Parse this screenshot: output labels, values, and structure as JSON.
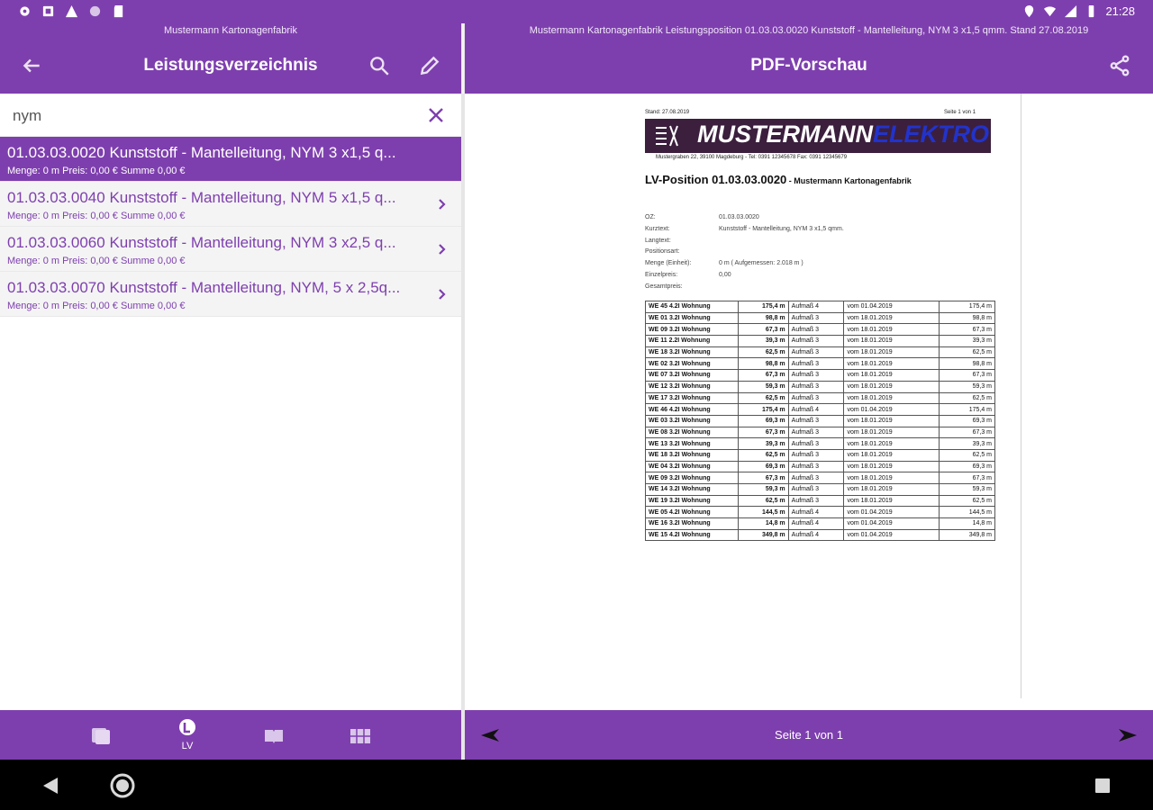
{
  "status_bar": {
    "time": "21:28",
    "left_icons": [
      "gear-icon",
      "image-icon",
      "warning-icon",
      "circle-icon",
      "sd-card-icon"
    ],
    "right_icons": [
      "location-icon",
      "wifi-icon",
      "signal-icon",
      "battery-icon"
    ]
  },
  "left_pane": {
    "subtitle": "Mustermann Kartonagenfabrik",
    "title": "Leistungsverzeichnis",
    "search": {
      "value": "nym",
      "placeholder": ""
    },
    "items": [
      {
        "title": "01.03.03.0020 Kunststoff - Mantelleitung, NYM 3 x1,5 q...",
        "meta": "Menge: 0 m Preis: 0,00 € Summe 0,00 €",
        "selected": true
      },
      {
        "title": "01.03.03.0040 Kunststoff - Mantelleitung, NYM 5 x1,5 q...",
        "meta": "Menge: 0 m Preis: 0,00 € Summe 0,00 €",
        "selected": false
      },
      {
        "title": "01.03.03.0060 Kunststoff - Mantelleitung, NYM 3 x2,5 q...",
        "meta": "Menge: 0 m Preis: 0,00 € Summe 0,00 €",
        "selected": false
      },
      {
        "title": "01.03.03.0070 Kunststoff - Mantelleitung, NYM, 5 x 2,5q...",
        "meta": "Menge: 0 m Preis: 0,00 € Summe 0,00 €",
        "selected": false
      }
    ],
    "bottom_tabs": [
      {
        "icon": "documents-icon",
        "label": ""
      },
      {
        "icon": "lv-icon",
        "label": "LV"
      },
      {
        "icon": "book-icon",
        "label": ""
      },
      {
        "icon": "grid-icon",
        "label": ""
      }
    ]
  },
  "right_pane": {
    "subtitle": "Mustermann Kartonagenfabrik Leistungsposition 01.03.03.0020 Kunststoff - Mantelleitung, NYM 3 x1,5 qmm. Stand 27.08.2019",
    "title": "PDF-Vorschau",
    "pager": "Seite 1 von 1"
  },
  "pdf": {
    "stand": "Stand: 27.08.2019",
    "page": "Seite 1 von 1",
    "logo_text_a": "MUSTERMANN",
    "logo_text_b": "ELEKTRO",
    "address": "Mustergraben 22, 39100 Magdeburg  -  Tel: 0391 12345678  Fax: 0391 12345679",
    "heading": "LV-Position 01.03.03.0020",
    "heading_small": " - Mustermann Kartonagenfabrik",
    "info": [
      {
        "label": "OZ:",
        "value": "01.03.03.0020"
      },
      {
        "label": "Kurztext:",
        "value": "Kunststoff - Mantelleitung, NYM 3 x1,5 qmm."
      },
      {
        "label": "Langtext:",
        "value": ""
      },
      {
        "label": "Positionsart:",
        "value": ""
      },
      {
        "label": "Menge (Einheit):",
        "value": "0 m ( Aufgemessen: 2.018 m )"
      },
      {
        "label": "Einzelpreis:",
        "value": "0,00"
      },
      {
        "label": "Gesamtpreis:",
        "value": ""
      }
    ],
    "rows": [
      [
        "WE 45 4.2I Wohnung",
        "175,4 m",
        "Aufmaß 4",
        "vom 01.04.2019",
        "175,4 m"
      ],
      [
        "WE 01 3.2I Wohnung",
        "98,8 m",
        "Aufmaß 3",
        "vom 18.01.2019",
        "98,8 m"
      ],
      [
        "WE 09 3.2I Wohnung",
        "67,3 m",
        "Aufmaß 3",
        "vom 18.01.2019",
        "67,3 m"
      ],
      [
        "WE 11 2.2I Wohnung",
        "39,3 m",
        "Aufmaß 3",
        "vom 18.01.2019",
        "39,3 m"
      ],
      [
        "WE 18 3.2I Wohnung",
        "62,5 m",
        "Aufmaß 3",
        "vom 18.01.2019",
        "62,5 m"
      ],
      [
        "WE 02 3.2I Wohnung",
        "98,8 m",
        "Aufmaß 3",
        "vom 18.01.2019",
        "98,8 m"
      ],
      [
        "WE 07 3.2I Wohnung",
        "67,3 m",
        "Aufmaß 3",
        "vom 18.01.2019",
        "67,3 m"
      ],
      [
        "WE 12 3.2I Wohnung",
        "59,3 m",
        "Aufmaß 3",
        "vom 18.01.2019",
        "59,3 m"
      ],
      [
        "WE 17 3.2I Wohnung",
        "62,5 m",
        "Aufmaß 3",
        "vom 18.01.2019",
        "62,5 m"
      ],
      [
        "WE 46 4.2I Wohnung",
        "175,4 m",
        "Aufmaß 4",
        "vom 01.04.2019",
        "175,4 m"
      ],
      [
        "WE 03 3.2I Wohnung",
        "69,3 m",
        "Aufmaß 3",
        "vom 18.01.2019",
        "69,3 m"
      ],
      [
        "WE 08 3.2I Wohnung",
        "67,3 m",
        "Aufmaß 3",
        "vom 18.01.2019",
        "67,3 m"
      ],
      [
        "WE 13 3.2I Wohnung",
        "39,3 m",
        "Aufmaß 3",
        "vom 18.01.2019",
        "39,3 m"
      ],
      [
        "WE 18 3.2I Wohnung",
        "62,5 m",
        "Aufmaß 3",
        "vom 18.01.2019",
        "62,5 m"
      ],
      [
        "WE 04 3.2I Wohnung",
        "69,3 m",
        "Aufmaß 3",
        "vom 18.01.2019",
        "69,3 m"
      ],
      [
        "WE 09 3.2I Wohnung",
        "67,3 m",
        "Aufmaß 3",
        "vom 18.01.2019",
        "67,3 m"
      ],
      [
        "WE 14 3.2I Wohnung",
        "59,3 m",
        "Aufmaß 3",
        "vom 18.01.2019",
        "59,3 m"
      ],
      [
        "WE 19 3.2I Wohnung",
        "62,5 m",
        "Aufmaß 3",
        "vom 18.01.2019",
        "62,5 m"
      ],
      [
        "WE 05 4.2I Wohnung",
        "144,5 m",
        "Aufmaß 4",
        "vom 01.04.2019",
        "144,5 m"
      ],
      [
        "WE 16 3.2I Wohnung",
        "14,8 m",
        "Aufmaß 4",
        "vom 01.04.2019",
        "14,8 m"
      ],
      [
        "WE 15 4.2I Wohnung",
        "349,8 m",
        "Aufmaß 4",
        "vom 01.04.2019",
        "349,8 m"
      ]
    ]
  },
  "colors": {
    "accent": "#7e3fae",
    "selected_bg": "#7e3fae",
    "item_bg": "#f4f4f4"
  }
}
